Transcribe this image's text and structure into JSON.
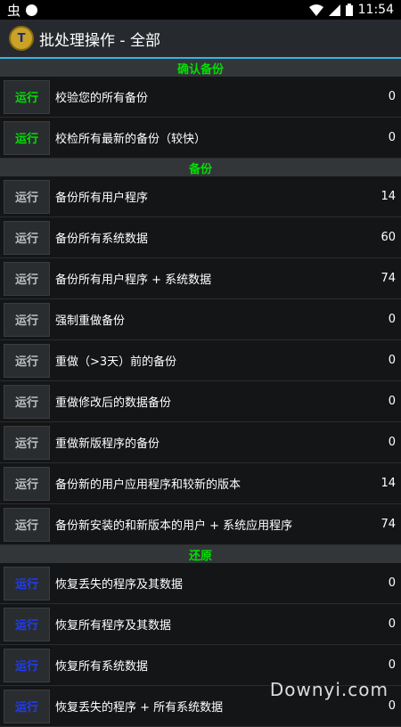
{
  "status": {
    "time": "11:54"
  },
  "app": {
    "title": "批处理操作 - 全部"
  },
  "sections": [
    {
      "title": "确认备份",
      "color": "green",
      "rows": [
        {
          "label": "校验您的所有备份",
          "count": "0"
        },
        {
          "label": "校检所有最新的备份（较快）",
          "count": "0"
        }
      ]
    },
    {
      "title": "备份",
      "color": "gray",
      "rows": [
        {
          "label": "备份所有用户程序",
          "count": "14"
        },
        {
          "label": "备份所有系统数据",
          "count": "60"
        },
        {
          "label": "备份所有用户程序 + 系统数据",
          "count": "74"
        },
        {
          "label": "强制重做备份",
          "count": "0"
        },
        {
          "label": "重做（>3天）前的备份",
          "count": "0"
        },
        {
          "label": "重做修改后的数据备份",
          "count": "0"
        },
        {
          "label": "重做新版程序的备份",
          "count": "0"
        },
        {
          "label": "备份新的用户应用程序和较新的版本",
          "count": "14"
        },
        {
          "label": "备份新安装的和新版本的用户 + 系统应用程序",
          "count": "74"
        }
      ]
    },
    {
      "title": "还原",
      "color": "blue",
      "rows": [
        {
          "label": "恢复丢失的程序及其数据",
          "count": "0"
        },
        {
          "label": "恢复所有程序及其数据",
          "count": "0"
        },
        {
          "label": "恢复所有系统数据",
          "count": "0"
        },
        {
          "label": "恢复丢失的程序 + 所有系统数据",
          "count": "0"
        }
      ]
    }
  ],
  "run_label": "运行",
  "watermark": "Downyi.com",
  "colors": {
    "accent": "#33b5e5",
    "green": "#00e000",
    "blue": "#1e3cff"
  },
  "icons": {
    "status_left": [
      "bug-icon",
      "circle-icon"
    ],
    "status_right": [
      "wifi-icon",
      "signal-icon",
      "battery-icon"
    ]
  }
}
